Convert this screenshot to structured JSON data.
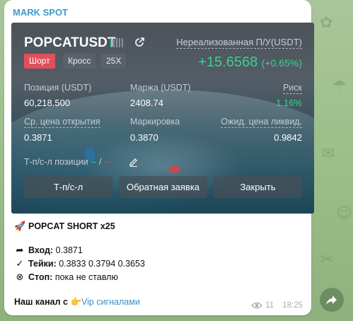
{
  "channel": {
    "sender_name": "MARK SPOT"
  },
  "position_card": {
    "symbol": "POPCATUSDT",
    "unrealized_label": "Нереализованная П/У(USDT)",
    "unrealized_value": "+15.6568",
    "unrealized_pct": "(+0.65%)",
    "tags": {
      "side": "Шорт",
      "margin_mode": "Кросс",
      "leverage": "25X"
    },
    "fields": {
      "position_label": "Позиция (USDT)",
      "position_value": "60,218.500",
      "margin_label": "Маржа (USDT)",
      "margin_value": "2408.74",
      "risk_label": "Риск",
      "risk_value": "1.16%",
      "entry_label": "Ср. цена открытия",
      "entry_value": "0.3871",
      "mark_label": "Маркировка",
      "mark_value": "0.3870",
      "liq_label": "Ожид. цена ликвид.",
      "liq_value": "0.9842"
    },
    "tpsl_label": "Т-п/с-л позиции",
    "tpsl_tp": "--",
    "tpsl_sep": "/",
    "tpsl_sl": "--",
    "buttons": {
      "tpsl": "Т-п/с-л",
      "reverse": "Обратная заявка",
      "close": "Закрыть"
    },
    "colors": {
      "profit": "#3ad18f",
      "short": "#e0505c"
    },
    "strength_bars": {
      "filled": 1,
      "total": 5
    }
  },
  "message": {
    "headline_emoji": "🚀",
    "headline": "POPCAT SHORT x25",
    "entry_label": "Вход:",
    "entry_value": "0.3871",
    "targets_label": "Тейки:",
    "targets_value": "0.3833 0.3794 0.3653",
    "stop_label": "Стоп:",
    "stop_value": "пока не ставлю",
    "channel_prefix": "Наш канал с",
    "channel_emoji": "👉",
    "channel_link": "Vip сигналами",
    "views": "11",
    "time": "18:25"
  }
}
